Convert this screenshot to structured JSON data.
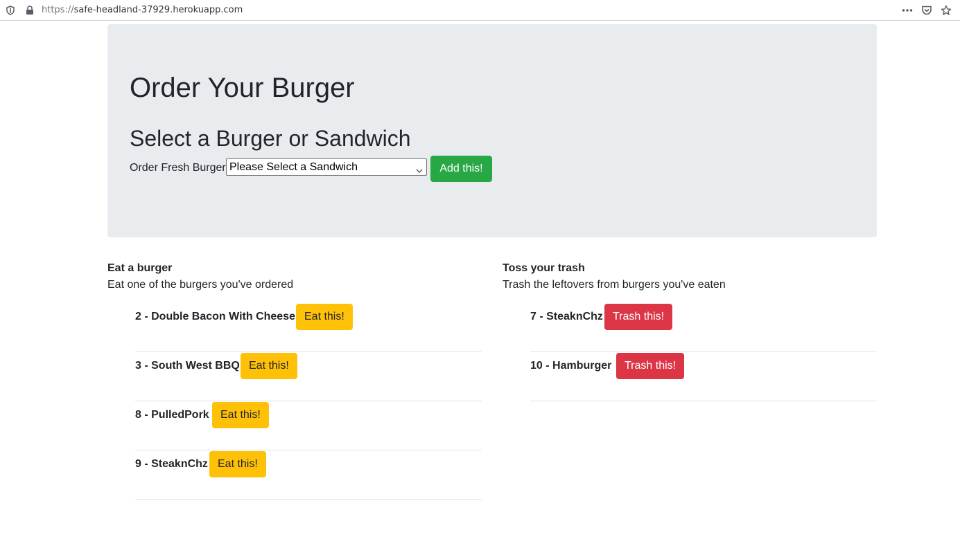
{
  "browser": {
    "url_scheme": "https://",
    "url_host": "safe-headland-37929.herokuapp.com",
    "icons": [
      "shield-icon",
      "lock-icon",
      "more-icon",
      "pocket-icon",
      "star-icon"
    ]
  },
  "jumbotron": {
    "title": "Order Your Burger",
    "subtitle": "Select a Burger or Sandwich",
    "order_label": "Order Fresh Burger",
    "select_value": "Please Select a Sandwich",
    "add_button": "Add this!"
  },
  "eat": {
    "heading": "Eat a burger",
    "description": "Eat one of the burgers you've ordered",
    "items": [
      {
        "name": "2 - Double Bacon With Cheese",
        "button": "Eat this!"
      },
      {
        "name": "3 - South West BBQ",
        "button": "Eat this!"
      },
      {
        "name": "8 - PulledPork",
        "button": "Eat this!"
      },
      {
        "name": "9 - SteaknChz",
        "button": "Eat this!"
      }
    ]
  },
  "trash": {
    "heading": "Toss your trash",
    "description": "Trash the leftovers from burgers you've eaten",
    "items": [
      {
        "name": "7 - SteaknChz",
        "button": "Trash this!"
      },
      {
        "name": "10 - Hamburger",
        "button": "Trash this!"
      }
    ]
  },
  "colors": {
    "add": "#28a745",
    "eat": "#ffc107",
    "trash": "#dc3545",
    "jumbotron": "#e9ecef"
  }
}
